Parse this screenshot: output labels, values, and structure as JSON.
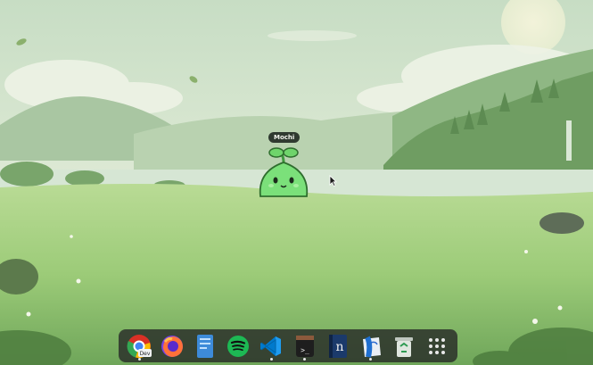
{
  "pet": {
    "name": "Mochi"
  },
  "dock": {
    "items": [
      {
        "id": "chrome-dev",
        "icon": "chrome-dev-icon",
        "label": "Dev",
        "running": true
      },
      {
        "id": "firefox",
        "icon": "firefox-icon",
        "running": false
      },
      {
        "id": "files",
        "icon": "files-icon",
        "running": false
      },
      {
        "id": "spotify",
        "icon": "spotify-icon",
        "running": false
      },
      {
        "id": "vscode",
        "icon": "vscode-icon",
        "running": true
      },
      {
        "id": "terminal",
        "icon": "terminal-icon",
        "label": ">_",
        "running": true
      },
      {
        "id": "notion",
        "icon": "notion-icon",
        "label": "n",
        "running": false
      },
      {
        "id": "finder",
        "icon": "finder-icon",
        "running": true
      },
      {
        "id": "trash",
        "icon": "trash-icon",
        "running": false
      },
      {
        "id": "app-grid",
        "icon": "app-grid-icon",
        "running": false
      }
    ]
  },
  "colors": {
    "sky": "#cfe3cf",
    "meadow": "#9dc975",
    "dock": "#2a2d2a",
    "pet": "#7be07a"
  }
}
